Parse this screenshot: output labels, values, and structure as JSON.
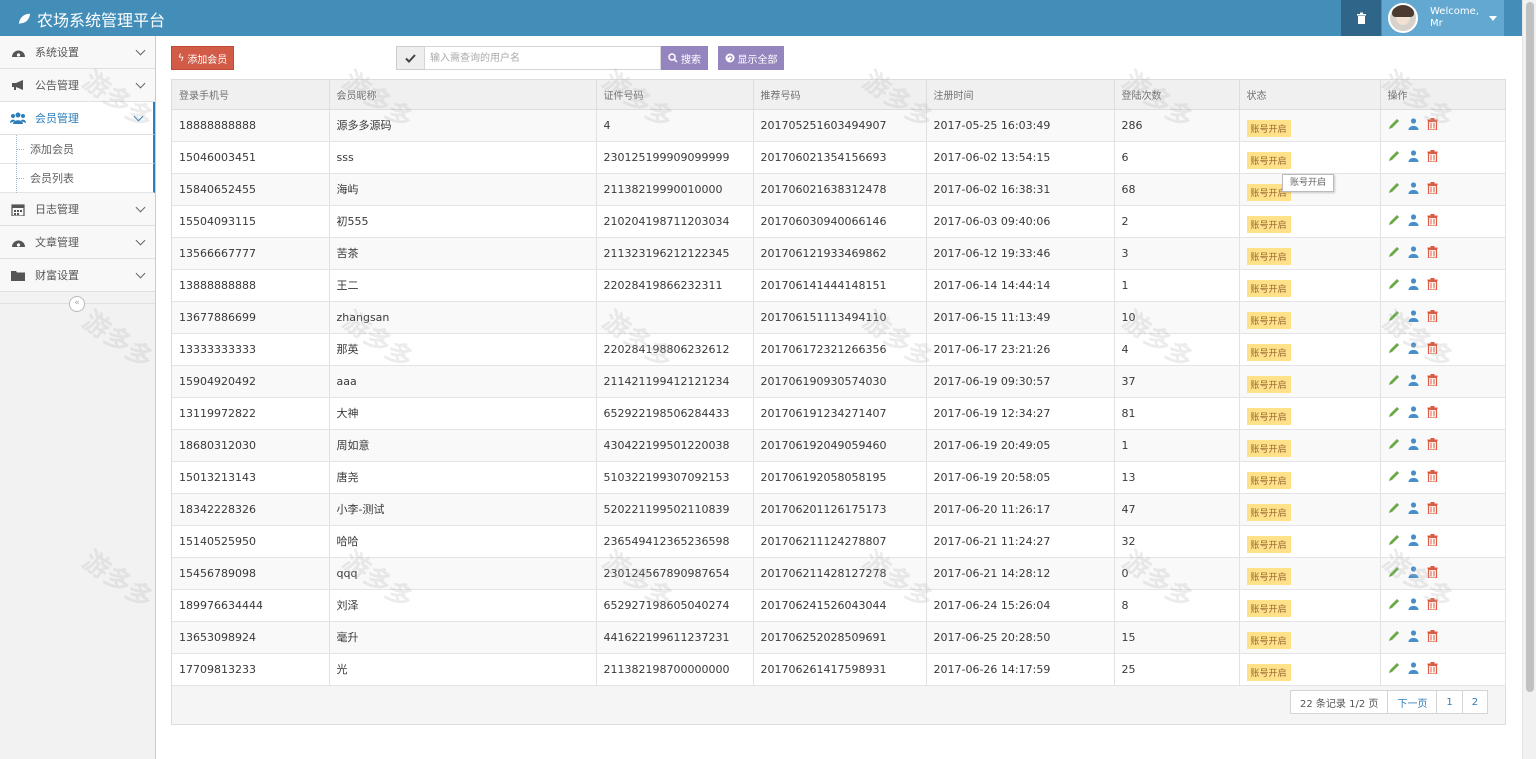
{
  "app": {
    "title": "农场系统管理平台"
  },
  "user": {
    "welcome": "Welcome,",
    "name": "Mr"
  },
  "sidebar": {
    "items": [
      {
        "label": "系统设置",
        "icon": "dashboard-icon"
      },
      {
        "label": "公告管理",
        "icon": "bullhorn-icon"
      },
      {
        "label": "会员管理",
        "icon": "users-icon",
        "active": true
      },
      {
        "label": "日志管理",
        "icon": "calendar-icon"
      },
      {
        "label": "文章管理",
        "icon": "dashboard-icon"
      },
      {
        "label": "财富设置",
        "icon": "folder-icon"
      }
    ],
    "sub_items": [
      {
        "label": "添加会员"
      },
      {
        "label": "会员列表"
      }
    ]
  },
  "toolbar": {
    "add_label": "添加会员",
    "search_placeholder": "输入需查询的用户名",
    "search_label": "搜索",
    "show_all_label": "显示全部"
  },
  "table": {
    "columns": [
      "登录手机号",
      "会员昵称",
      "证件号码",
      "推荐号码",
      "注册时间",
      "登陆次数",
      "状态",
      "操作"
    ],
    "rows": [
      [
        "18888888888",
        "源多多源码",
        "4",
        "201705251603494907",
        "2017-05-25 16:03:49",
        "286",
        "账号开启"
      ],
      [
        "15046003451",
        "sss",
        "230125199909099999",
        "201706021354156693",
        "2017-06-02 13:54:15",
        "6",
        "账号开启"
      ],
      [
        "15840652455",
        "海屿",
        "21138219990010000",
        "201706021638312478",
        "2017-06-02 16:38:31",
        "68",
        "账号开启"
      ],
      [
        "15504093115",
        "初555",
        "210204198711203034",
        "201706030940066146",
        "2017-06-03 09:40:06",
        "2",
        "账号开启"
      ],
      [
        "13566667777",
        "苦茶",
        "211323196212122345",
        "201706121933469862",
        "2017-06-12 19:33:46",
        "3",
        "账号开启"
      ],
      [
        "13888888888",
        "王二",
        "22028419866232311",
        "201706141444148151",
        "2017-06-14 14:44:14",
        "1",
        "账号开启"
      ],
      [
        "13677886699",
        "zhangsan",
        "",
        "201706151113494110",
        "2017-06-15 11:13:49",
        "10",
        "账号开启"
      ],
      [
        "13333333333",
        "那英",
        "220284198806232612",
        "201706172321266356",
        "2017-06-17 23:21:26",
        "4",
        "账号开启"
      ],
      [
        "15904920492",
        "aaa",
        "211421199412121234",
        "201706190930574030",
        "2017-06-19 09:30:57",
        "37",
        "账号开启"
      ],
      [
        "13119972822",
        "大神",
        "652922198506284433",
        "201706191234271407",
        "2017-06-19 12:34:27",
        "81",
        "账号开启"
      ],
      [
        "18680312030",
        "周如意",
        "430422199501220038",
        "201706192049059460",
        "2017-06-19 20:49:05",
        "1",
        "账号开启"
      ],
      [
        "15013213143",
        "唐尧",
        "510322199307092153",
        "201706192058058195",
        "2017-06-19 20:58:05",
        "13",
        "账号开启"
      ],
      [
        "18342228326",
        "小李-测试",
        "520221199502110839",
        "201706201126175173",
        "2017-06-20 11:26:17",
        "47",
        "账号开启"
      ],
      [
        "15140525950",
        "哈哈",
        "236549412365236598",
        "201706211124278807",
        "2017-06-21 11:24:27",
        "32",
        "账号开启"
      ],
      [
        "15456789098",
        "qqq",
        "230124567890987654",
        "201706211428127278",
        "2017-06-21 14:28:12",
        "0",
        "账号开启"
      ],
      [
        "189976634444",
        "刘泽",
        "652927198605040274",
        "201706241526043044",
        "2017-06-24 15:26:04",
        "8",
        "账号开启"
      ],
      [
        "13653098924",
        "毫升",
        "441622199611237231",
        "201706252028509691",
        "2017-06-25 20:28:50",
        "15",
        "账号开启"
      ],
      [
        "17709813233",
        "光",
        "211382198700000000",
        "201706261417598931",
        "2017-06-26 14:17:59",
        "25",
        "账号开启"
      ]
    ]
  },
  "tooltip": "账号开启",
  "pager": {
    "summary": "22 条记录 1/2 页",
    "next": "下一页",
    "page1": "1",
    "page2": "2"
  },
  "watermark": "游多多",
  "colors": {
    "navbar": "#438eb9",
    "add_button": "#d15b47",
    "search_button": "#9585bf",
    "badge": "#fee188"
  }
}
